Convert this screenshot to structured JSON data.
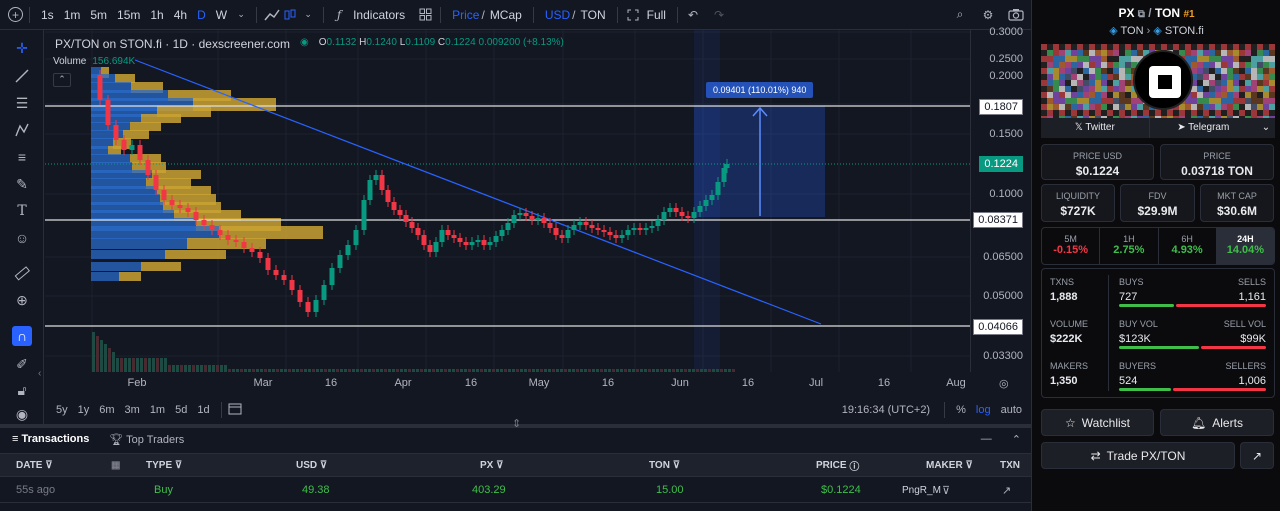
{
  "toolbar": {
    "intervals": [
      "1s",
      "1m",
      "5m",
      "15m",
      "1h",
      "4h",
      "D",
      "W"
    ],
    "indicators": "Indicators",
    "price_label": "Price",
    "mcap_label": "MCap",
    "usd_label": "USD",
    "ton_label": "TON",
    "full_label": "Full"
  },
  "chart": {
    "title": "PX/TON on STON.fi · 1D · dexscreener.com",
    "o_label": "O",
    "o": "0.1132",
    "h_label": "H",
    "h": "0.1240",
    "l_label": "L",
    "l": "0.1109",
    "c_label": "C",
    "c": "0.1224",
    "change": "0.009200 (+8.13%)",
    "volume_label": "Volume",
    "volume": "156.694K",
    "measure": "0.09401 (110.01%) 940"
  },
  "price_axis": {
    "labels": [
      "0.3000",
      "0.2500",
      "0.2000",
      "0.1500",
      "0.1000",
      "0.06500",
      "0.05000",
      "0.03300"
    ],
    "hlines": [
      "0.1807",
      "0.08371",
      "0.04066"
    ],
    "current": "0.1224"
  },
  "time_axis": [
    "Feb",
    "Mar",
    "16",
    "Apr",
    "16",
    "May",
    "16",
    "Jun",
    "16",
    "Jul",
    "16",
    "Aug"
  ],
  "range": {
    "items": [
      "5y",
      "1y",
      "6m",
      "3m",
      "1m",
      "5d",
      "1d"
    ],
    "clock": "19:16:34 (UTC+2)",
    "pct": "%",
    "log": "log",
    "auto": "auto"
  },
  "tabs": {
    "transactions": "Transactions",
    "top_traders": "Top Traders"
  },
  "table": {
    "headers": [
      "DATE",
      "TYPE",
      "USD",
      "PX",
      "TON",
      "PRICE",
      "MAKER",
      "TXN"
    ],
    "rows": [
      [
        "55s ago",
        "Buy",
        "49.38",
        "403.29",
        "15.00",
        "$0.1224",
        "PngR_M"
      ]
    ]
  },
  "pair": {
    "base": "PX",
    "quote": "TON",
    "rank": "#1",
    "chain": "TON",
    "dex": "STON.fi"
  },
  "social": {
    "twitter": "Twitter",
    "telegram": "Telegram"
  },
  "prices": {
    "usd_label": "PRICE USD",
    "usd": "$0.1224",
    "ton_label": "PRICE",
    "ton": "0.03718 TON"
  },
  "metrics": [
    {
      "label": "LIQUIDITY",
      "value": "$727K"
    },
    {
      "label": "FDV",
      "value": "$29.9M"
    },
    {
      "label": "MKT CAP",
      "value": "$30.6M"
    }
  ],
  "changes": [
    {
      "label": "5M",
      "value": "-0.15%",
      "color": "#f23645"
    },
    {
      "label": "1H",
      "value": "2.75%",
      "color": "#3fbf4a"
    },
    {
      "label": "6H",
      "value": "4.93%",
      "color": "#3fbf4a"
    },
    {
      "label": "24H",
      "value": "14.04%",
      "color": "#3fbf4a"
    }
  ],
  "stats": {
    "txns_label": "TXNS",
    "txns": "1,888",
    "buys_label": "BUYS",
    "buys": "727",
    "sells_label": "SELLS",
    "sells": "1,161",
    "volume_label": "VOLUME",
    "volume": "$222K",
    "buy_vol_label": "BUY VOL",
    "buy_vol": "$123K",
    "sell_vol_label": "SELL VOL",
    "sell_vol": "$99K",
    "makers_label": "MAKERS",
    "makers": "1,350",
    "buyers_label": "BUYERS",
    "buyers": "524",
    "sellers_label": "SELLERS",
    "sellers": "1,006"
  },
  "actions": {
    "watchlist": "Watchlist",
    "alerts": "Alerts",
    "trade": "Trade PX/TON"
  },
  "colors": {
    "green": "#089981",
    "red": "#f23645",
    "blue": "#2962ff",
    "bg": "#131722"
  }
}
